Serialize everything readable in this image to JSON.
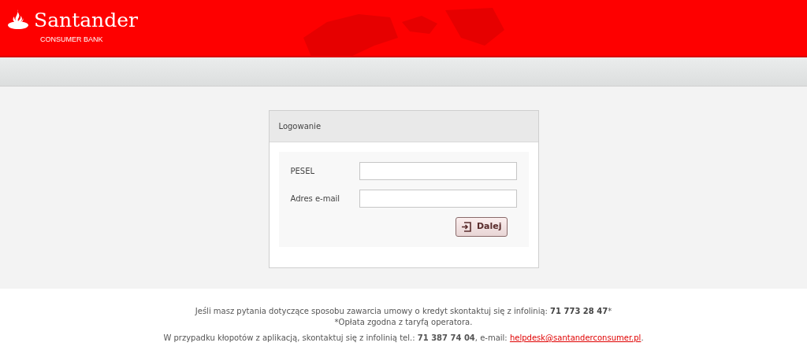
{
  "header": {
    "brand": "Santander",
    "subbrand": "CONSUMER BANK"
  },
  "login": {
    "title": "Logowanie",
    "fields": [
      {
        "label": "PESEL"
      },
      {
        "label": "Adres e-mail"
      }
    ],
    "submit": "Dalej"
  },
  "footer": {
    "lines": [
      "Jeśli masz pytania dotyczące sposobu zawarcia umowy o kredyt skontaktuj się z infolinią: **71 773 28 47***",
      "*Opłata zgodna z taryfą operatora."
    ],
    "contact": {
      "text": "W przypadku kłopotów z aplikacją, skontaktuj się z infolinią tel.: **71 387 74 04**, e-mail:",
      "link": "helpdesk@santanderconsumer.pl",
      "end": "."
    }
  }
}
